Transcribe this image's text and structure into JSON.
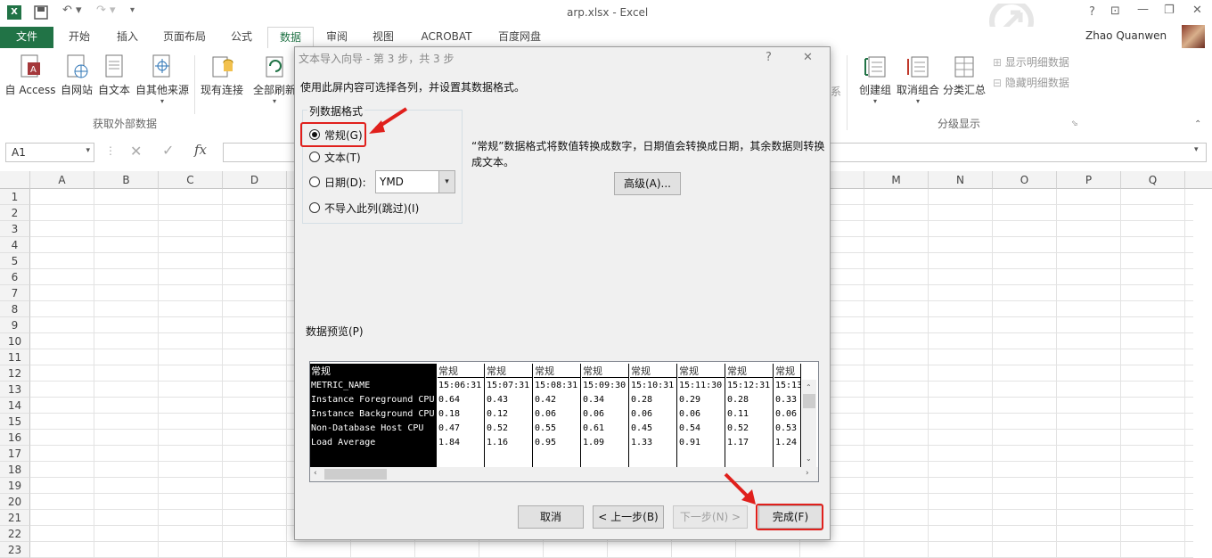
{
  "window": {
    "title": "arp.xlsx - Excel",
    "user": "Zhao Quanwen",
    "help": "?"
  },
  "tabs": [
    "文件",
    "开始",
    "插入",
    "页面布局",
    "公式",
    "数据",
    "审阅",
    "视图",
    "ACROBAT",
    "百度网盘"
  ],
  "ribbon": {
    "get_external": [
      "自 Access",
      "自网站",
      "自文本",
      "自其他来源"
    ],
    "existing_conn": "现有连接",
    "refresh_all": "全部刷新",
    "group_external_label": "获取外部数据",
    "outline": [
      "创建组",
      "取消组合",
      "分类汇总"
    ],
    "show_detail": "显示明细数据",
    "hide_detail": "隐藏明细数据",
    "group_outline_label": "分级显示",
    "partial_label": "系"
  },
  "formula_bar": {
    "name_box": "A1",
    "fx": "fx"
  },
  "grid": {
    "columns": [
      "A",
      "B",
      "C",
      "D",
      "",
      "",
      "",
      "",
      "",
      "",
      "",
      "",
      "",
      "M",
      "N",
      "O",
      "P",
      "Q",
      "R"
    ],
    "rows": [
      "1",
      "2",
      "3",
      "4",
      "5",
      "6",
      "7",
      "8",
      "9",
      "10",
      "11",
      "12",
      "13",
      "14",
      "15",
      "16",
      "17",
      "18",
      "19",
      "20",
      "21",
      "22",
      "23"
    ]
  },
  "dialog": {
    "title": "文本导入向导 - 第 3 步，共 3 步",
    "help": "?",
    "close": "✕",
    "instruction": "使用此屏内容可选择各列，并设置其数据格式。",
    "group_title": "列数据格式",
    "options": {
      "general": "常规(G)",
      "text": "文本(T)",
      "date": "日期(D):",
      "skip": "不导入此列(跳过)(I)"
    },
    "date_value": "YMD",
    "description": "“常规”数据格式将数值转换成数字，日期值会转换成日期，其余数据则转换成文本。",
    "advanced": "高级(A)...",
    "preview_label": "数据预览(P)",
    "preview": {
      "headers": [
        "常规",
        "常规",
        "常规",
        "常规",
        "常规",
        "常规",
        "常规",
        "常规",
        "常规"
      ],
      "rows": [
        [
          "METRIC_NAME",
          "15:06:31",
          "15:07:31",
          "15:08:31",
          "15:09:30",
          "15:10:31",
          "15:11:30",
          "15:12:31",
          "15:13"
        ],
        [
          "Instance Foreground CPU",
          "0.64",
          "0.43",
          "0.42",
          "0.34",
          "0.28",
          "0.29",
          "0.28",
          "0.33"
        ],
        [
          "Instance Background CPU",
          "0.18",
          "0.12",
          "0.06",
          "0.06",
          "0.06",
          "0.06",
          "0.11",
          "0.06"
        ],
        [
          "Non-Database Host CPU",
          "0.47",
          "0.52",
          "0.55",
          "0.61",
          "0.45",
          "0.54",
          "0.52",
          "0.53"
        ],
        [
          "Load Average",
          "1.84",
          "1.16",
          "0.95",
          "1.09",
          "1.33",
          "0.91",
          "1.17",
          "1.24"
        ]
      ]
    },
    "buttons": {
      "cancel": "取消",
      "back": "< 上一步(B)",
      "next": "下一步(N) >",
      "finish": "完成(F)"
    }
  },
  "colors": {
    "excel_green": "#217346",
    "highlight_red": "#e0201c"
  }
}
